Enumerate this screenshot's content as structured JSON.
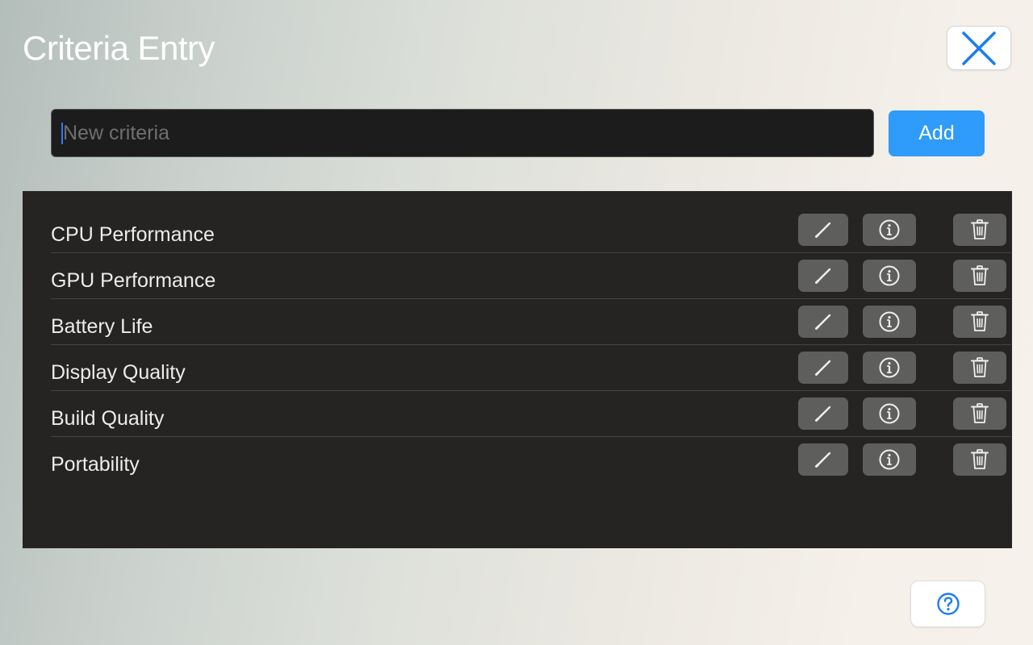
{
  "window": {
    "title": "Criteria Entry"
  },
  "entry": {
    "placeholder": "New criteria",
    "value": "",
    "add_label": "Add"
  },
  "criteria": [
    {
      "label": "CPU Performance"
    },
    {
      "label": "GPU Performance"
    },
    {
      "label": "Battery Life"
    },
    {
      "label": "Display Quality"
    },
    {
      "label": "Build Quality"
    },
    {
      "label": "Portability"
    }
  ],
  "icons": {
    "close": "close-icon",
    "edit": "pencil-icon",
    "info": "info-icon",
    "delete": "trash-icon",
    "help": "question-mark-icon"
  },
  "colors": {
    "accent": "#2f9bfa",
    "close_icon": "#1a7cf5",
    "panel_bg": "#252422",
    "input_bg": "#1c1c1c",
    "action_button_bg": "#5e5e5c"
  }
}
